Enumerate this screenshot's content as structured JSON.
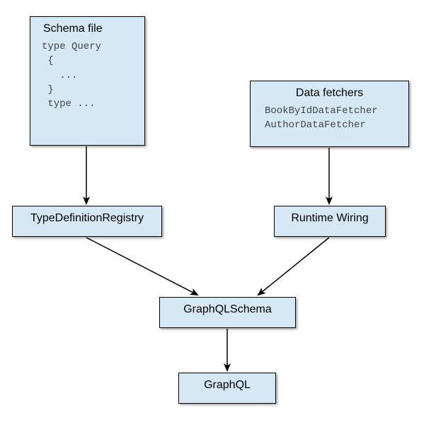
{
  "schemaFile": {
    "title": "Schema file",
    "code": "type Query\n {\n   ...\n }\n type ..."
  },
  "dataFetchers": {
    "title": "Data fetchers",
    "code": "BookByIdDataFetcher\nAuthorDataFetcher"
  },
  "typeDefRegistry": {
    "title": "TypeDefinitionRegistry"
  },
  "runtimeWiring": {
    "title": "Runtime Wiring"
  },
  "graphqlSchema": {
    "title": "GraphQLSchema"
  },
  "graphql": {
    "title": "GraphQL"
  },
  "chart_data": {
    "type": "flow-diagram",
    "nodes": [
      {
        "id": "schema-file",
        "label": "Schema file",
        "content": [
          "type Query",
          " {",
          "   ...",
          " }",
          " type ..."
        ]
      },
      {
        "id": "data-fetchers",
        "label": "Data fetchers",
        "content": [
          "BookByIdDataFetcher",
          "AuthorDataFetcher"
        ]
      },
      {
        "id": "type-definition-registry",
        "label": "TypeDefinitionRegistry"
      },
      {
        "id": "runtime-wiring",
        "label": "Runtime Wiring"
      },
      {
        "id": "graphql-schema",
        "label": "GraphQLSchema"
      },
      {
        "id": "graphql",
        "label": "GraphQL"
      }
    ],
    "edges": [
      {
        "from": "schema-file",
        "to": "type-definition-registry"
      },
      {
        "from": "data-fetchers",
        "to": "runtime-wiring"
      },
      {
        "from": "type-definition-registry",
        "to": "graphql-schema"
      },
      {
        "from": "runtime-wiring",
        "to": "graphql-schema"
      },
      {
        "from": "graphql-schema",
        "to": "graphql"
      }
    ]
  }
}
